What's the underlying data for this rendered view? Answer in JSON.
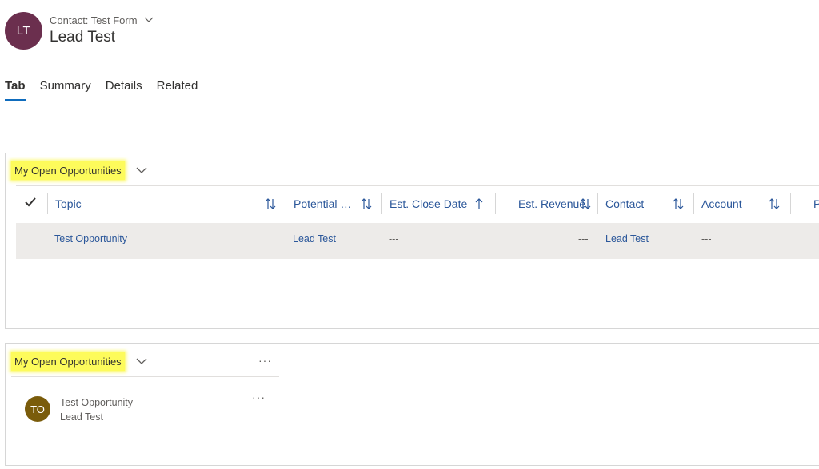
{
  "header": {
    "avatar_initials": "LT",
    "avatar_color": "#6b2f4e",
    "form_label": "Contact: Test Form",
    "record_name": "Lead Test"
  },
  "tabs": [
    {
      "label": "Tab",
      "active": true
    },
    {
      "label": "Summary",
      "active": false
    },
    {
      "label": "Details",
      "active": false
    },
    {
      "label": "Related",
      "active": false
    }
  ],
  "grid_section": {
    "title": "My Open Opportunities",
    "columns": [
      "Topic",
      "Potential Cu...",
      "Est. Close Date",
      "Est. Revenue",
      "Contact",
      "Account",
      "P"
    ],
    "rows": [
      {
        "topic": "Test Opportunity",
        "potential_customer": "Lead Test",
        "est_close_date": "---",
        "est_revenue": "---",
        "contact": "Lead Test",
        "account": "---"
      }
    ]
  },
  "list_section": {
    "title": "My Open Opportunities",
    "more_label": "···",
    "items": [
      {
        "initials": "TO",
        "avatar_color": "#7a5c0b",
        "line1": "Test Opportunity",
        "line2": "Lead Test",
        "more_label": "···"
      }
    ]
  },
  "colors": {
    "accent": "#0f6cbd",
    "link": "#2b579a",
    "highlight": "#fdfb5b"
  }
}
